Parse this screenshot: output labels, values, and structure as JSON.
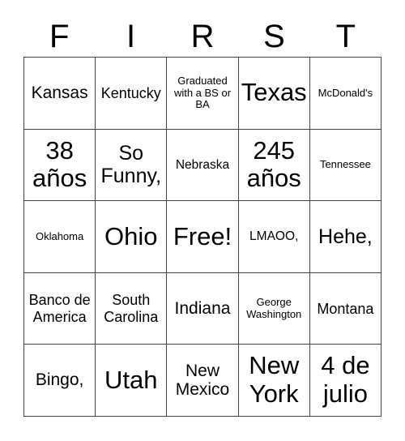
{
  "header": {
    "letters": [
      "F",
      "I",
      "R",
      "S",
      "T"
    ]
  },
  "grid": {
    "rows": [
      [
        {
          "text": "Kansas",
          "size": "fs-l"
        },
        {
          "text": "Kentucky",
          "size": "fs-m"
        },
        {
          "text": "Graduated with a BS or BA",
          "size": "fs-xs"
        },
        {
          "text": "Texas",
          "size": "fs-xxl"
        },
        {
          "text": "McDonald's",
          "size": "fs-xs"
        }
      ],
      [
        {
          "text": "38 años",
          "size": "fs-xxl"
        },
        {
          "text": "So Funny,",
          "size": "fs-xl"
        },
        {
          "text": "Nebraska",
          "size": "fs-s"
        },
        {
          "text": "245 años",
          "size": "fs-xxl"
        },
        {
          "text": "Tennessee",
          "size": "fs-xs"
        }
      ],
      [
        {
          "text": "Oklahoma",
          "size": "fs-xs"
        },
        {
          "text": "Ohio",
          "size": "fs-xxl"
        },
        {
          "text": "Free!",
          "size": "fs-xxl"
        },
        {
          "text": "LMAOO,",
          "size": "fs-s"
        },
        {
          "text": "Hehe,",
          "size": "fs-xl"
        }
      ],
      [
        {
          "text": "Banco de America",
          "size": "fs-m"
        },
        {
          "text": "South Carolina",
          "size": "fs-m"
        },
        {
          "text": "Indiana",
          "size": "fs-l"
        },
        {
          "text": "George Washington",
          "size": "fs-xs"
        },
        {
          "text": "Montana",
          "size": "fs-m"
        }
      ],
      [
        {
          "text": "Bingo,",
          "size": "fs-l"
        },
        {
          "text": "Utah",
          "size": "fs-xxl"
        },
        {
          "text": "New Mexico",
          "size": "fs-l"
        },
        {
          "text": "New York",
          "size": "fs-xxl"
        },
        {
          "text": "4 de julio",
          "size": "fs-xxl"
        }
      ]
    ]
  },
  "colors": {
    "grid_line": "#444444",
    "text": "#000000",
    "background": "#ffffff"
  }
}
